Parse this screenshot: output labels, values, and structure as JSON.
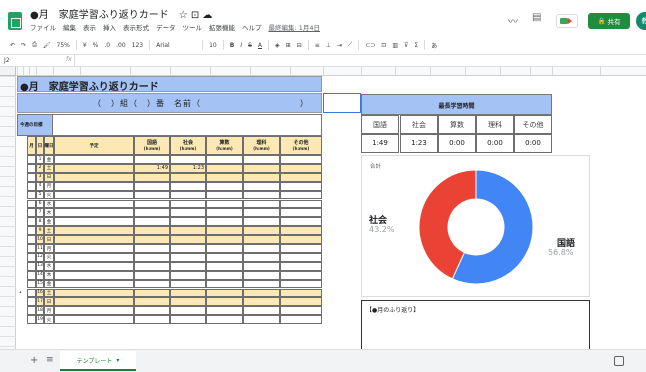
{
  "header": {
    "doc_title": "●月　家庭学習ふり返りカード　☆ ⊡ ☁",
    "menu": [
      "ファイル",
      "編集",
      "表示",
      "挿入",
      "表示形式",
      "データ",
      "ツール",
      "拡張機能",
      "ヘルプ"
    ],
    "last_edit": "最終編集: 1月4日",
    "share_label": "共有",
    "avatar_text": "教"
  },
  "toolbar": {
    "zoom": "75%",
    "currency": "¥",
    "percent": "%",
    "dec_less": ".0",
    "dec_more": ".00",
    "format_123": "123",
    "font": "Arial",
    "font_size": "10",
    "bold": "B",
    "italic": "I",
    "strike": "S",
    "underline_a": "A"
  },
  "formula_bar": {
    "cell_ref": "J2",
    "fx": "fx"
  },
  "sheet": {
    "title": "●月　家庭学習ふり返りカード",
    "class_line": "（　）組（　）番　名前（　　　　　　　　　　　）",
    "goal_label": "今週の目標",
    "table_headers": {
      "month": "月",
      "day": "日",
      "weekday": "曜日",
      "plan": "予定"
    },
    "subjects": [
      {
        "name": "国語",
        "unit": "(h:mm)"
      },
      {
        "name": "社会",
        "unit": "(h:mm)"
      },
      {
        "name": "算数",
        "unit": "(h:mm)"
      },
      {
        "name": "理科",
        "unit": "(h:mm)"
      },
      {
        "name": "その他",
        "unit": "(h:mm)"
      }
    ],
    "rows": [
      {
        "day": "1",
        "wd": "金",
        "hl": false,
        "kokugo": "",
        "shakai": ""
      },
      {
        "day": "2",
        "wd": "土",
        "hl": true,
        "kokugo": "1:49",
        "shakai": "1:23"
      },
      {
        "day": "3",
        "wd": "日",
        "hl": true,
        "kokugo": "",
        "shakai": ""
      },
      {
        "day": "4",
        "wd": "月",
        "hl": false,
        "kokugo": "",
        "shakai": ""
      },
      {
        "day": "5",
        "wd": "火",
        "hl": false,
        "kokugo": "",
        "shakai": ""
      },
      {
        "day": "6",
        "wd": "水",
        "hl": false,
        "kokugo": "",
        "shakai": ""
      },
      {
        "day": "7",
        "wd": "木",
        "hl": false,
        "kokugo": "",
        "shakai": ""
      },
      {
        "day": "8",
        "wd": "金",
        "hl": false,
        "kokugo": "",
        "shakai": ""
      },
      {
        "day": "9",
        "wd": "土",
        "hl": true,
        "kokugo": "",
        "shakai": ""
      },
      {
        "day": "10",
        "wd": "日",
        "hl": true,
        "kokugo": "",
        "shakai": ""
      },
      {
        "day": "11",
        "wd": "月",
        "hl": false,
        "kokugo": "",
        "shakai": ""
      },
      {
        "day": "12",
        "wd": "火",
        "hl": false,
        "kokugo": "",
        "shakai": ""
      },
      {
        "day": "13",
        "wd": "水",
        "hl": false,
        "kokugo": "",
        "shakai": ""
      },
      {
        "day": "14",
        "wd": "木",
        "hl": false,
        "kokugo": "",
        "shakai": ""
      },
      {
        "day": "15",
        "wd": "金",
        "hl": false,
        "kokugo": "",
        "shakai": ""
      },
      {
        "day": "16",
        "wd": "土",
        "hl": true,
        "kokugo": "",
        "shakai": ""
      },
      {
        "day": "17",
        "wd": "日",
        "hl": true,
        "kokugo": "",
        "shakai": ""
      },
      {
        "day": "18",
        "wd": "月",
        "hl": false,
        "kokugo": "",
        "shakai": ""
      },
      {
        "day": "19",
        "wd": "火",
        "hl": false,
        "kokugo": "",
        "shakai": ""
      }
    ],
    "summary": {
      "title": "最長学習時間",
      "headers": [
        "国語",
        "社会",
        "算数",
        "理科",
        "その他"
      ],
      "values": [
        "1:49",
        "1:23",
        "0:00",
        "0:00",
        "0:00"
      ]
    },
    "reflection_label": "【●月のふり返り】"
  },
  "chart_data": {
    "type": "pie",
    "title": "合計",
    "labels": [
      "国語",
      "社会"
    ],
    "values": [
      56.8,
      43.2
    ],
    "percent_labels": [
      "56.8%",
      "43.2%"
    ],
    "colors": [
      "#4285f4",
      "#ea4335"
    ],
    "donut": true
  },
  "bottom": {
    "sheet_tab": "テンプレート",
    "add_sheet": "+",
    "all_sheets": "≡"
  }
}
